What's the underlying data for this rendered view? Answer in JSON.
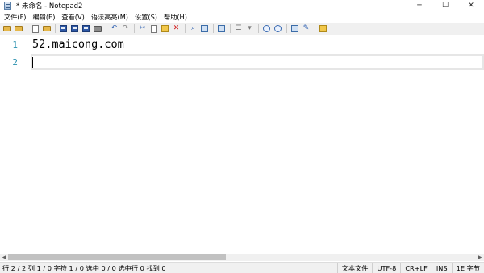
{
  "window": {
    "title": "* 未命名 - Notepad2",
    "minimize_glyph": "─",
    "maximize_glyph": "☐",
    "close_glyph": "✕"
  },
  "menu": {
    "items": [
      {
        "label": "文件(F)"
      },
      {
        "label": "编辑(E)"
      },
      {
        "label": "查看(V)"
      },
      {
        "label": "语法高亮(M)"
      },
      {
        "label": "设置(S)"
      },
      {
        "label": "帮助(H)"
      }
    ]
  },
  "editor": {
    "line_numbers": [
      "1",
      "2"
    ],
    "lines": [
      "52.maicong.com",
      ""
    ]
  },
  "statusbar": {
    "position_info": "行 2 / 2  列 1 / 0  字符 1 / 0  选中 0 / 0  选中行 0  找到 0",
    "file_type": "文本文件",
    "encoding": "UTF-8",
    "line_ending": "CR+LF",
    "mode": "INS",
    "extra": "1E 字节"
  },
  "colors": {
    "line_number": "#2b91af",
    "toolbar_bg": "#f0f0f0",
    "current_line_border": "#e6e6e6"
  }
}
